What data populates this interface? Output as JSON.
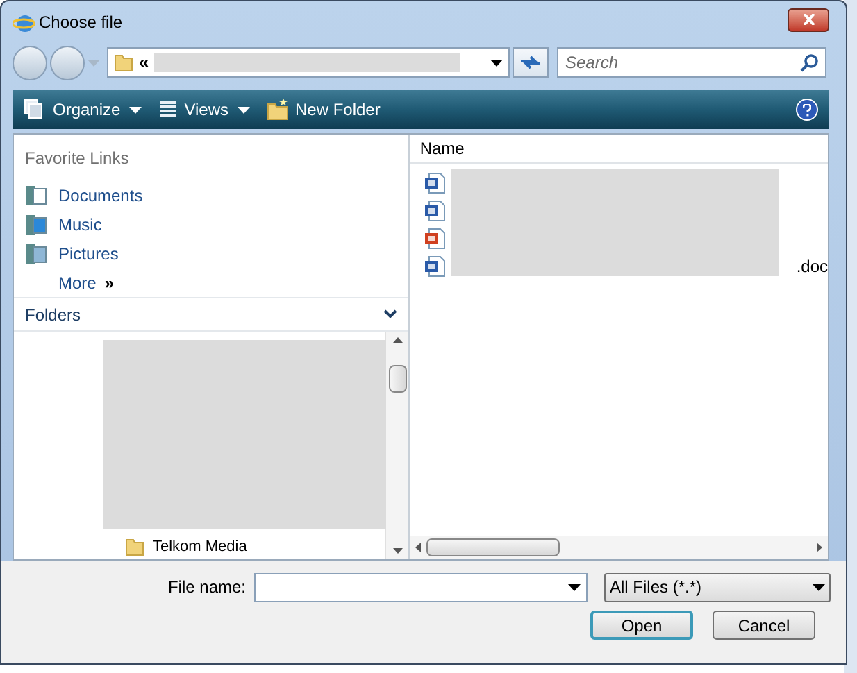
{
  "window": {
    "title": "Choose file"
  },
  "address": {
    "prefix": "«"
  },
  "search": {
    "placeholder": "Search"
  },
  "toolbar": [
    {
      "kind": "organize",
      "label": "Organize",
      "dropdown": true
    },
    {
      "kind": "views",
      "label": "Views",
      "dropdown": true
    },
    {
      "kind": "new-folder",
      "label": "New Folder",
      "dropdown": false
    }
  ],
  "favorite_links": {
    "title": "Favorite Links",
    "items": [
      {
        "kind": "documents",
        "label": "Documents"
      },
      {
        "kind": "music",
        "label": "Music"
      },
      {
        "kind": "pictures",
        "label": "Pictures"
      }
    ],
    "more": "More",
    "more_icon": "»"
  },
  "folders": {
    "title": "Folders",
    "expanded": true,
    "items": [
      {
        "label": "Telkom Media"
      }
    ]
  },
  "file_list": {
    "column": "Name",
    "files": [
      {
        "kind": "word"
      },
      {
        "kind": "word"
      },
      {
        "kind": "pdf"
      },
      {
        "kind": "word",
        "visible_text": ".doc"
      }
    ]
  },
  "file_name": {
    "label": "File name:"
  },
  "file_type": {
    "value": "All Files (*.*)"
  },
  "buttons": [
    {
      "label": "Open",
      "default": true
    },
    {
      "label": "Cancel",
      "default": false
    }
  ]
}
